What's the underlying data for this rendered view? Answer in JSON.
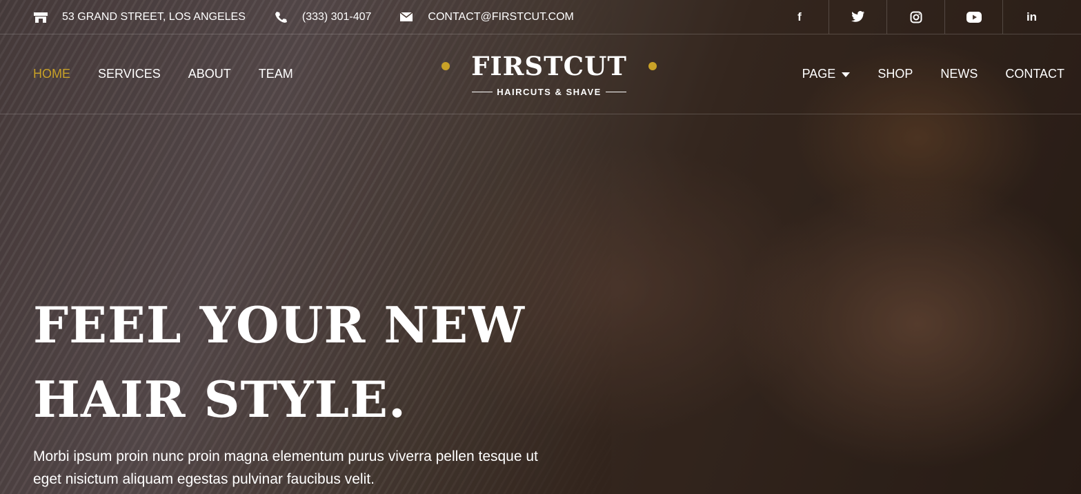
{
  "colors": {
    "accent": "#c9a227",
    "text": "#ffffff"
  },
  "topbar": {
    "address": {
      "icon": "store-icon",
      "text": "53 GRAND STREET, LOS ANGELES"
    },
    "phone": {
      "icon": "phone-icon",
      "text": "(333) 301-407"
    },
    "email": {
      "icon": "envelope-icon",
      "text": "CONTACT@FIRSTCUT.COM"
    },
    "socials": [
      {
        "icon": "facebook-icon",
        "glyph": "f"
      },
      {
        "icon": "twitter-icon",
        "glyph": "t"
      },
      {
        "icon": "instagram-icon",
        "glyph": "◎"
      },
      {
        "icon": "youtube-icon",
        "glyph": "▶"
      },
      {
        "icon": "linkedin-icon",
        "glyph": "in"
      }
    ]
  },
  "nav": {
    "left": [
      "HOME",
      "SERVICES",
      "ABOUT",
      "TEAM"
    ],
    "right": [
      "PAGE",
      "SHOP",
      "NEWS",
      "CONTACT"
    ],
    "active": "HOME"
  },
  "logo": {
    "title": "FIRSTCUT",
    "subtitle": "HAIRCUTS & SHAVE"
  },
  "hero": {
    "title_line1": "FEEL YOUR NEW",
    "title_line2": "HAIR STYLE.",
    "text": "Morbi ipsum proin nunc proin magna elementum purus viverra pellen tesque ut eget nisictum aliquam egestas pulvinar faucibus velit."
  }
}
